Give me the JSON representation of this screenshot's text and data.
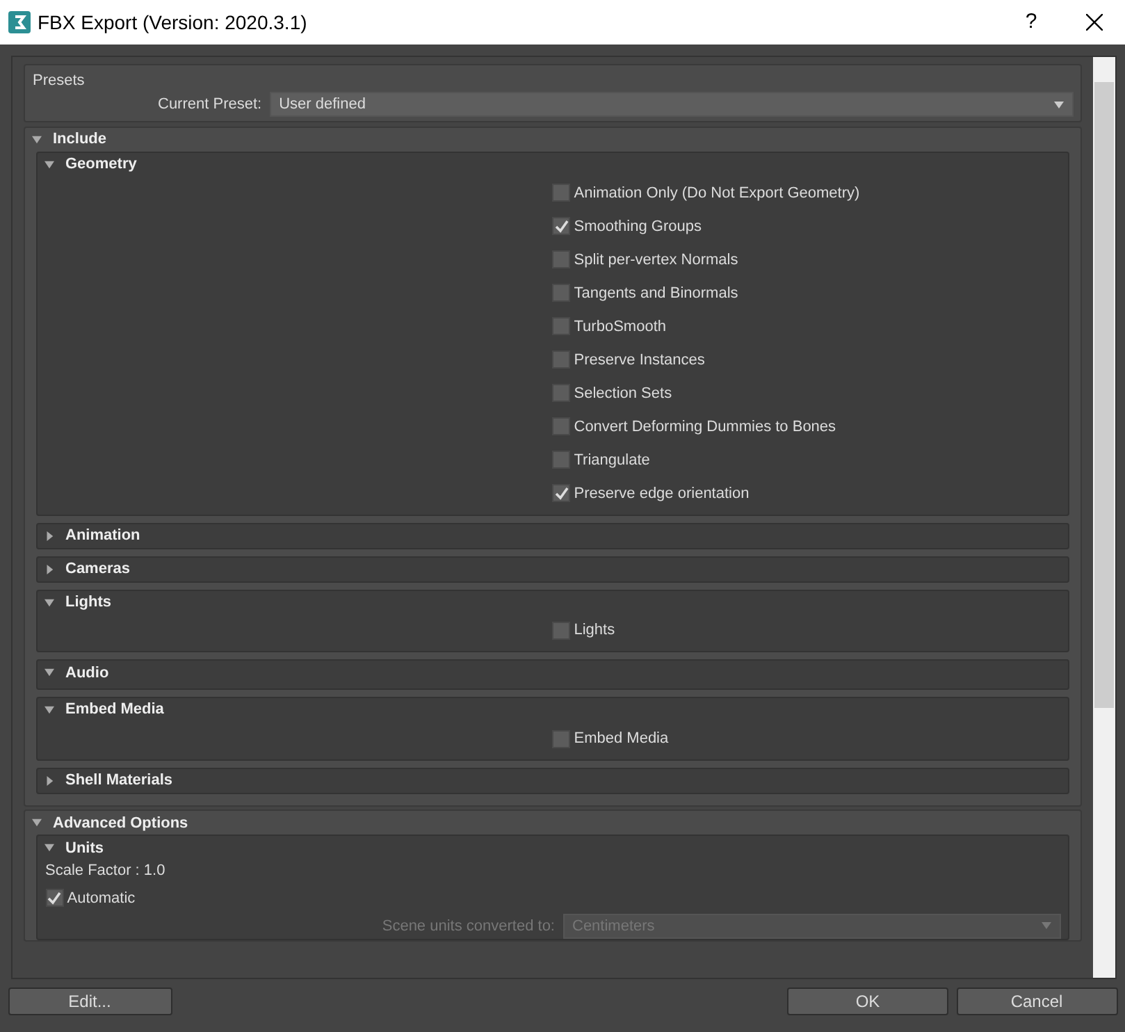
{
  "window": {
    "title": "FBX Export (Version: 2020.3.1)",
    "help": "?"
  },
  "presets": {
    "title": "Presets",
    "preset_label": "Current Preset:",
    "preset_value": "User defined"
  },
  "include": {
    "title": "Include",
    "expanded": true,
    "subsections": [
      {
        "title": "Geometry",
        "expanded": true,
        "options": [
          {
            "label": "Animation Only (Do Not Export Geometry)",
            "checked": false
          },
          {
            "label": "Smoothing Groups",
            "checked": true
          },
          {
            "label": "Split per-vertex Normals",
            "checked": false
          },
          {
            "label": "Tangents and Binormals",
            "checked": false
          },
          {
            "label": "TurboSmooth",
            "checked": false
          },
          {
            "label": "Preserve Instances",
            "checked": false
          },
          {
            "label": "Selection Sets",
            "checked": false
          },
          {
            "label": "Convert Deforming Dummies to Bones",
            "checked": false
          },
          {
            "label": "Triangulate",
            "checked": false
          },
          {
            "label": "Preserve edge orientation",
            "checked": true
          }
        ]
      },
      {
        "title": "Animation",
        "expanded": false
      },
      {
        "title": "Cameras",
        "expanded": false
      },
      {
        "title": "Lights",
        "expanded": true,
        "options": [
          {
            "label": "Lights",
            "checked": false
          }
        ]
      },
      {
        "title": "Audio",
        "expanded": true
      },
      {
        "title": "Embed Media",
        "expanded": true,
        "options": [
          {
            "label": "Embed Media",
            "checked": false
          }
        ]
      },
      {
        "title": "Shell Materials",
        "expanded": false
      }
    ]
  },
  "advanced": {
    "title": "Advanced Options",
    "expanded": true,
    "units": {
      "title": "Units",
      "expanded": true,
      "scale_factor": "Scale Factor : 1.0",
      "automatic": {
        "label": "Automatic",
        "checked": true
      },
      "converted_label": "Scene units converted to:",
      "converted_value": "Centimeters",
      "disabled": true
    }
  },
  "buttons": [
    {
      "label": "Edit..."
    },
    {
      "label": "OK"
    },
    {
      "label": "Cancel"
    }
  ]
}
